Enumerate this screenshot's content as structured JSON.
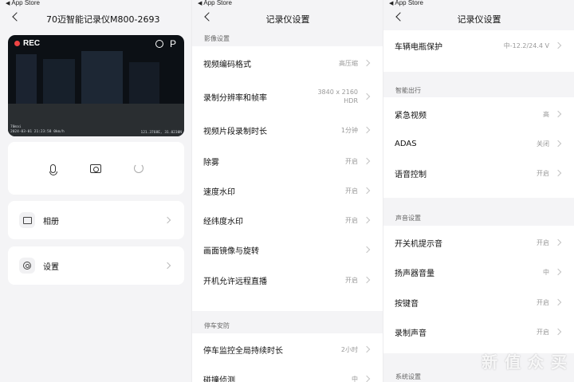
{
  "status_bar": {
    "label": "App Store"
  },
  "device_panel": {
    "title": "70迈智能记录仪M800-2693",
    "video": {
      "rec": "REC",
      "mode": "P",
      "timestamp": "2024-03-01 21:23:58",
      "speed": "0km/h",
      "coords": "121.3768E, 31.0230N",
      "brand": "70mai"
    },
    "controls": [
      "mic-icon",
      "camera-icon",
      "sync-icon"
    ],
    "menu": [
      {
        "label": "相册",
        "icon": "album-icon"
      },
      {
        "label": "设置",
        "icon": "settings-icon"
      }
    ]
  },
  "settings_panel_1": {
    "title": "记录仪设置",
    "sections": [
      {
        "label": "影像设置"
      },
      {
        "label": "停车安防"
      }
    ],
    "rows": [
      {
        "label": "视频编码格式",
        "value": "高压缩"
      },
      {
        "label": "录制分辨率和帧率",
        "value_line1": "3840 x 2160",
        "value_line2": "HDR"
      },
      {
        "label": "视频片段录制时长",
        "value": "1分钟"
      },
      {
        "label": "除雾",
        "value": "开启"
      },
      {
        "label": "速度水印",
        "value": "开启"
      },
      {
        "label": "经纬度水印",
        "value": "开启"
      },
      {
        "label": "画面镜像与旋转",
        "value": ""
      },
      {
        "label": "开机允许远程直播",
        "value": "开启"
      },
      {
        "label": "停车监控全局持续时长",
        "value": "2小时"
      },
      {
        "label": "碰撞侦测",
        "value": "中"
      }
    ]
  },
  "settings_panel_2": {
    "title": "记录仪设置",
    "sections": [
      {
        "label": "智能出行"
      },
      {
        "label": "声音设置"
      },
      {
        "label": "系统设置"
      }
    ],
    "rows": [
      {
        "label": "车辆电瓶保护",
        "value": "中-12.2/24.4 V"
      },
      {
        "label": "紧急视频",
        "value": "高"
      },
      {
        "label": "ADAS",
        "value": "关闭"
      },
      {
        "label": "语音控制",
        "value": "开启"
      },
      {
        "label": "开关机提示音",
        "value": "开启"
      },
      {
        "label": "扬声器音量",
        "value": "中"
      },
      {
        "label": "按键音",
        "value": "开启"
      },
      {
        "label": "录制声音",
        "value": "开启"
      }
    ]
  },
  "watermark": "新 值 众 买"
}
